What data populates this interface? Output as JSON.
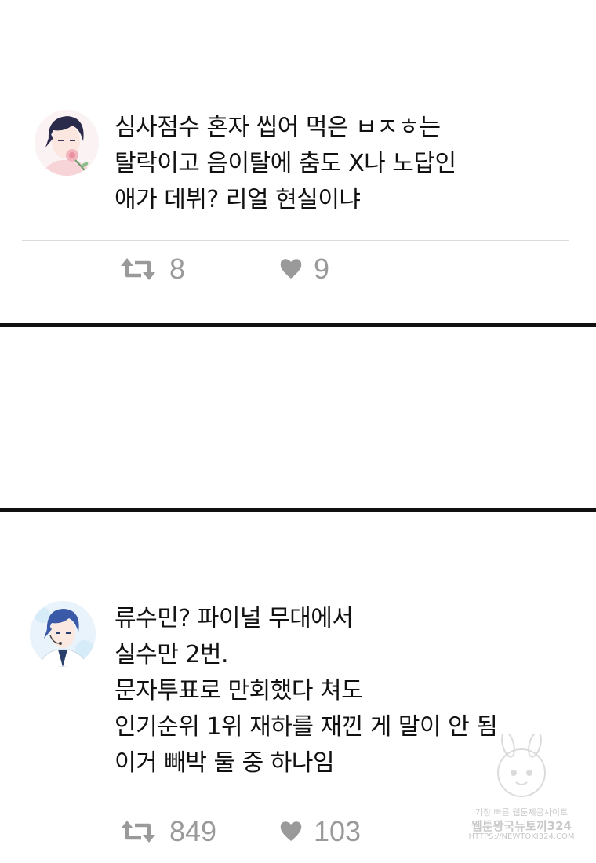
{
  "tweets": [
    {
      "lines": [
        "심사점수 혼자 씹어 먹은 ㅂㅈㅎ는",
        "탈락이고 음이탈에 춤도 X나 노답인",
        "애가 데뷔? 리얼 현실이냐"
      ],
      "retweets": "8",
      "likes": "9",
      "avatar": "dark-haired-boy-with-rose"
    },
    {
      "lines": [
        "류수민? 파이널 무대에서",
        "실수만 2번.",
        "문자투표로 만회했다 쳐도",
        "인기순위 1위 재하를 재낀 게 말이 안 됨",
        "이거 빼박 둘 중 하나임"
      ],
      "retweets": "849",
      "likes": "103",
      "avatar": "blue-haired-boy-with-headset-mic"
    }
  ],
  "icons": {
    "retweet": "retweet-icon",
    "like": "heart-icon"
  },
  "colors": {
    "text": "#111111",
    "meta": "#9a9a9a",
    "divider": "#dcdcdc",
    "panel_border": "#111111"
  },
  "watermark": {
    "line1": "가장 빠른 웹툰제공사이트",
    "line2": "웹툰왕국뉴토끼324",
    "line3": "HTTPS://NEWTOKI324.COM"
  }
}
